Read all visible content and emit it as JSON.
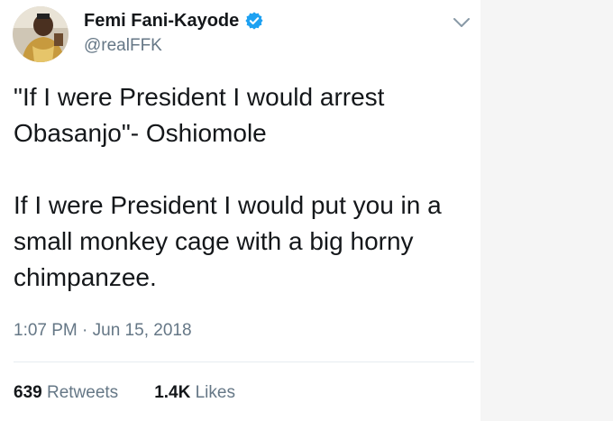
{
  "user": {
    "display_name": "Femi Fani-Kayode",
    "handle": "@realFFK",
    "verified": true
  },
  "tweet": {
    "paragraphs": [
      "\"If I were President I would arrest Obasanjo\"- Oshiomole",
      "If I were President I would put you in a small monkey cage with a big horny chimpanzee."
    ],
    "timestamp": "1:07 PM · Jun 15, 2018"
  },
  "stats": {
    "retweets_count": "639",
    "retweets_label": "Retweets",
    "likes_count": "1.4K",
    "likes_label": "Likes"
  },
  "icons": {
    "verified": "verified-badge-icon",
    "menu": "chevron-down-icon"
  },
  "colors": {
    "verified_blue": "#1da1f2",
    "secondary_text": "#657786",
    "primary_text": "#14171a"
  }
}
